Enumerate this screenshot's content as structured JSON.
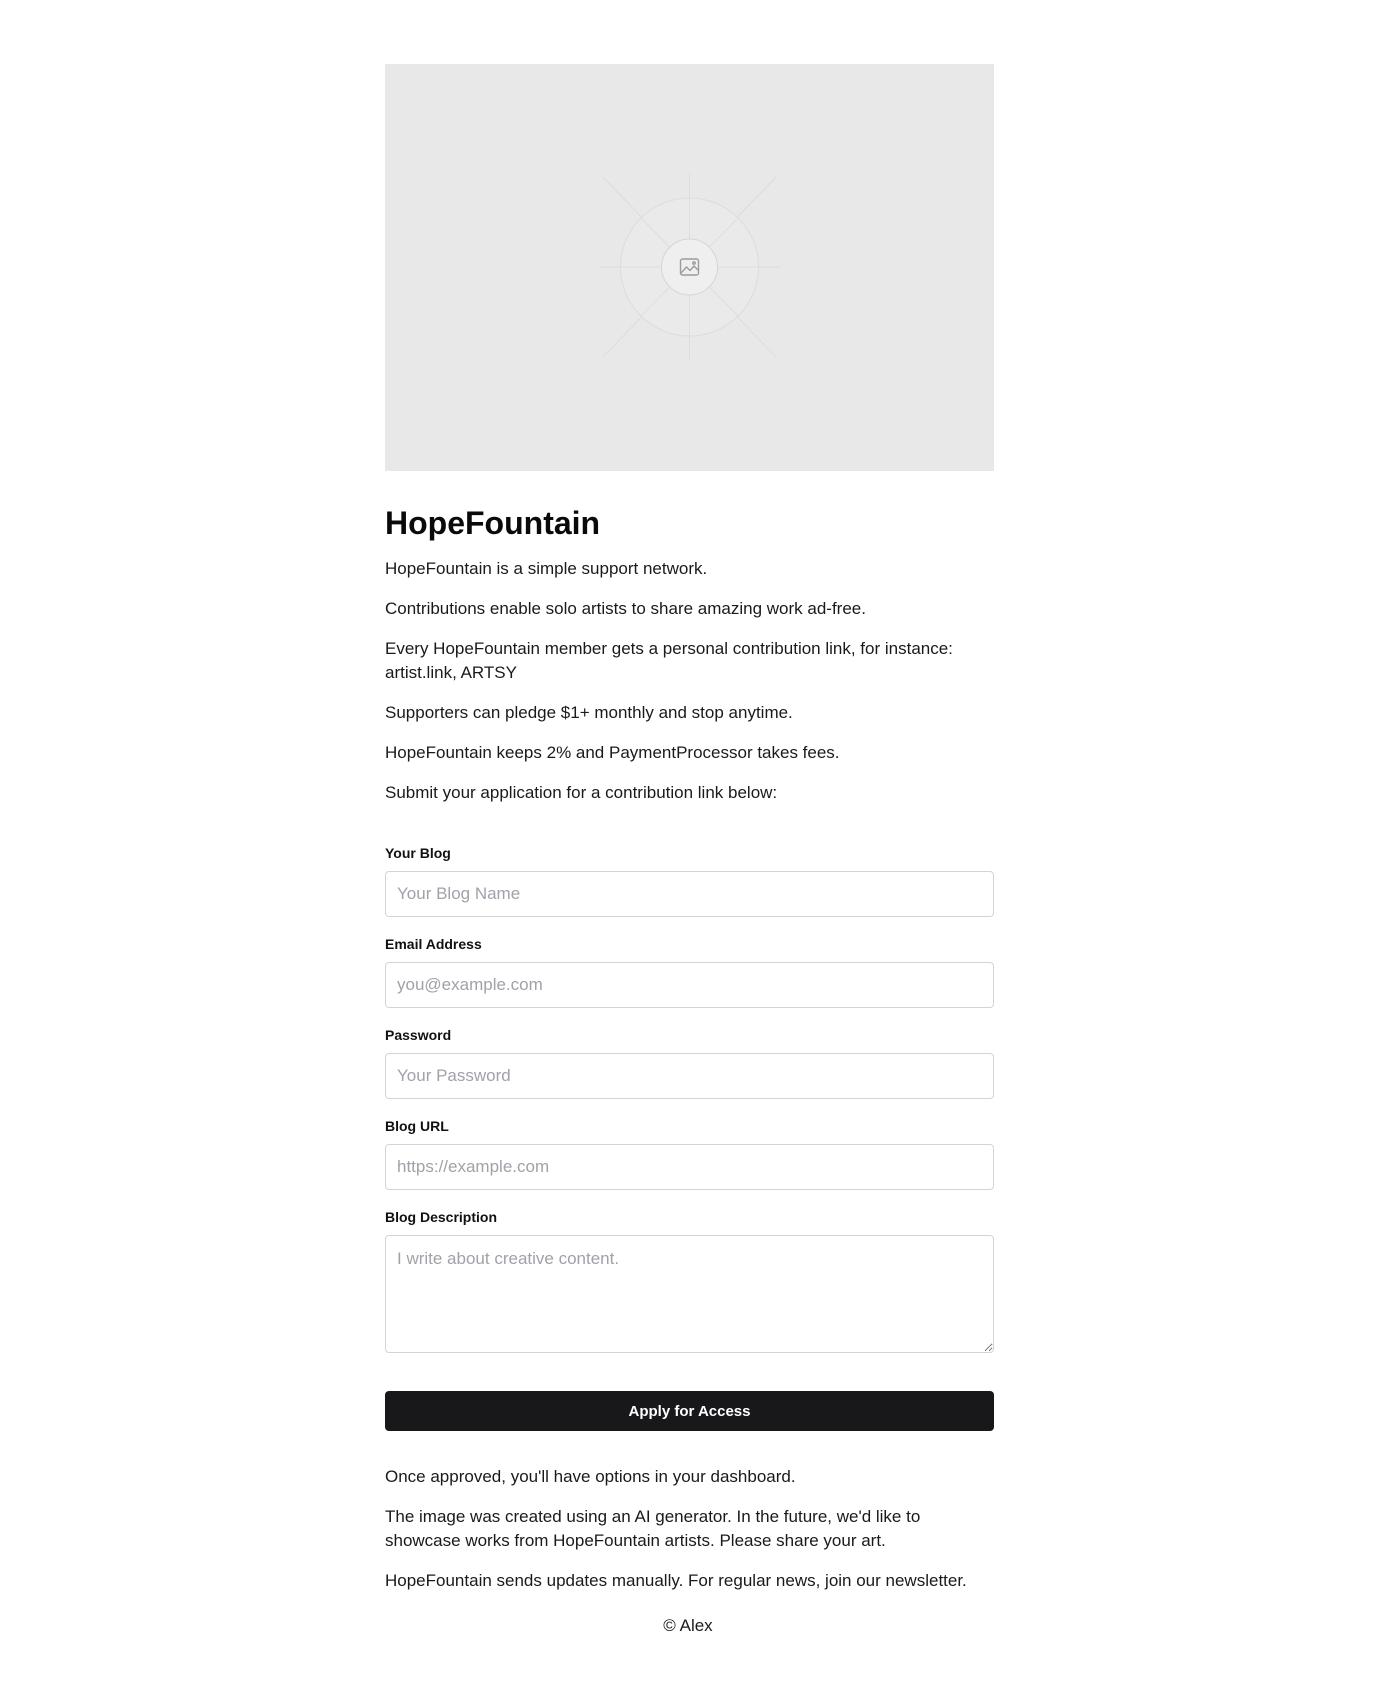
{
  "hero": {
    "icon": "image-placeholder-icon"
  },
  "title": "HopeFountain",
  "intro": [
    "HopeFountain is a simple support network.",
    "Contributions enable solo artists to share amazing work ad-free.",
    "Every HopeFountain member gets a personal contribution link, for instance: artist.link, ARTSY",
    "Supporters can pledge $1+ monthly and stop anytime.",
    "HopeFountain keeps 2% and PaymentProcessor takes fees.",
    "Submit your application for a contribution link below:"
  ],
  "form": {
    "blog_name": {
      "label": "Your Blog",
      "placeholder": "Your Blog Name",
      "value": ""
    },
    "email": {
      "label": "Email Address",
      "placeholder": "you@example.com",
      "value": ""
    },
    "password": {
      "label": "Password",
      "placeholder": "Your Password",
      "value": ""
    },
    "blog_url": {
      "label": "Blog URL",
      "placeholder": "https://example.com",
      "value": ""
    },
    "blog_description": {
      "label": "Blog Description",
      "placeholder": "I write about creative content.",
      "value": ""
    },
    "submit_label": "Apply for Access"
  },
  "outro": [
    "Once approved, you'll have options in your dashboard.",
    "The image was created using an AI generator. In the future, we'd like to showcase works from HopeFountain artists. Please share your art.",
    "HopeFountain sends updates manually. For regular news, join our newsletter."
  ],
  "footer": "© Alex",
  "colors": {
    "button_bg": "#18181b",
    "button_text": "#ffffff",
    "hero_bg": "#e8e8e8",
    "input_border": "#d4d4d8",
    "placeholder": "#a1a1aa"
  }
}
